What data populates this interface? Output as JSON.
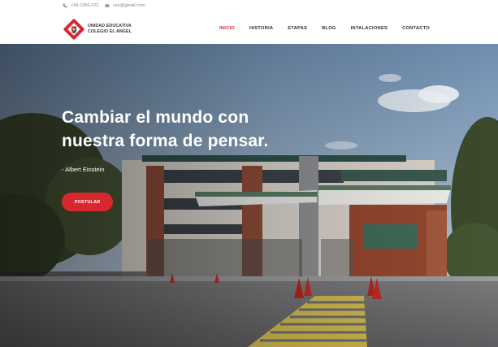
{
  "topbar": {
    "phone": "+58-2356-222",
    "email": "cee@gmail.com"
  },
  "brand": {
    "line1": "UNIDAD EDUCATIVA",
    "line2": "COLEGIO EL ANGEL"
  },
  "nav": {
    "items": [
      "INICIO",
      "HISTORIA",
      "ETAPAS",
      "BLOG",
      "INTALACIONES",
      "CONTACTO"
    ],
    "active": "INICIO"
  },
  "hero": {
    "headline_1": "Cambiar el mundo con",
    "headline_2": "nuestra forma de pensar.",
    "author": "- Albert Einstein",
    "cta": "POSTULAR"
  },
  "colors": {
    "accent": "#d8282e",
    "sky": "#7e99b6",
    "text": "#333333"
  }
}
